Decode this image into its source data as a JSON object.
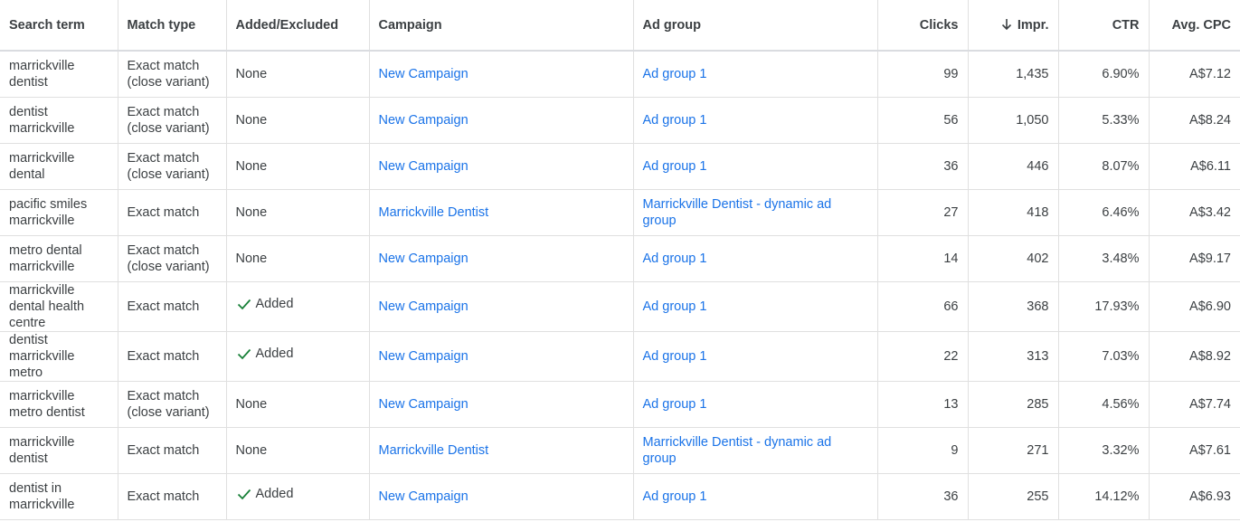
{
  "columns": {
    "search_term": "Search term",
    "match_type": "Match type",
    "added_excluded": "Added/Excluded",
    "campaign": "Campaign",
    "ad_group": "Ad group",
    "clicks": "Clicks",
    "impr": "Impr.",
    "ctr": "CTR",
    "avg_cpc": "Avg. CPC"
  },
  "colors": {
    "link": "#1a73e8",
    "added_check": "#188038",
    "text": "#3c4043"
  },
  "rows": [
    {
      "term": "marrickville dentist",
      "match": "Exact match (close variant)",
      "status": "None",
      "added": false,
      "campaign": "New Campaign",
      "ad_group": "Ad group 1",
      "clicks": "99",
      "impr": "1,435",
      "ctr": "6.90%",
      "cpc": "A$7.12"
    },
    {
      "term": "dentist marrickville",
      "match": "Exact match (close variant)",
      "status": "None",
      "added": false,
      "campaign": "New Campaign",
      "ad_group": "Ad group 1",
      "clicks": "56",
      "impr": "1,050",
      "ctr": "5.33%",
      "cpc": "A$8.24"
    },
    {
      "term": "marrickville dental",
      "match": "Exact match (close variant)",
      "status": "None",
      "added": false,
      "campaign": "New Campaign",
      "ad_group": "Ad group 1",
      "clicks": "36",
      "impr": "446",
      "ctr": "8.07%",
      "cpc": "A$6.11"
    },
    {
      "term": "pacific smiles marrickville",
      "match": "Exact match",
      "status": "None",
      "added": false,
      "campaign": "Marrickville Dentist",
      "ad_group": "Marrickville Dentist - dynamic ad group",
      "clicks": "27",
      "impr": "418",
      "ctr": "6.46%",
      "cpc": "A$3.42"
    },
    {
      "term": "metro dental marrickville",
      "match": "Exact match (close variant)",
      "status": "None",
      "added": false,
      "campaign": "New Campaign",
      "ad_group": "Ad group 1",
      "clicks": "14",
      "impr": "402",
      "ctr": "3.48%",
      "cpc": "A$9.17"
    },
    {
      "term": "marrickville dental health centre",
      "match": "Exact match",
      "status": "Added",
      "added": true,
      "campaign": "New Campaign",
      "ad_group": "Ad group 1",
      "clicks": "66",
      "impr": "368",
      "ctr": "17.93%",
      "cpc": "A$6.90"
    },
    {
      "term": "dentist marrickville metro",
      "match": "Exact match",
      "status": "Added",
      "added": true,
      "campaign": "New Campaign",
      "ad_group": "Ad group 1",
      "clicks": "22",
      "impr": "313",
      "ctr": "7.03%",
      "cpc": "A$8.92"
    },
    {
      "term": "marrickville metro dentist",
      "match": "Exact match (close variant)",
      "status": "None",
      "added": false,
      "campaign": "New Campaign",
      "ad_group": "Ad group 1",
      "clicks": "13",
      "impr": "285",
      "ctr": "4.56%",
      "cpc": "A$7.74"
    },
    {
      "term": "marrickville dentist",
      "match": "Exact match",
      "status": "None",
      "added": false,
      "campaign": "Marrickville Dentist",
      "ad_group": "Marrickville Dentist - dynamic ad group",
      "clicks": "9",
      "impr": "271",
      "ctr": "3.32%",
      "cpc": "A$7.61"
    },
    {
      "term": "dentist in marrickville",
      "match": "Exact match",
      "status": "Added",
      "added": true,
      "campaign": "New Campaign",
      "ad_group": "Ad group 1",
      "clicks": "36",
      "impr": "255",
      "ctr": "14.12%",
      "cpc": "A$6.93"
    }
  ]
}
